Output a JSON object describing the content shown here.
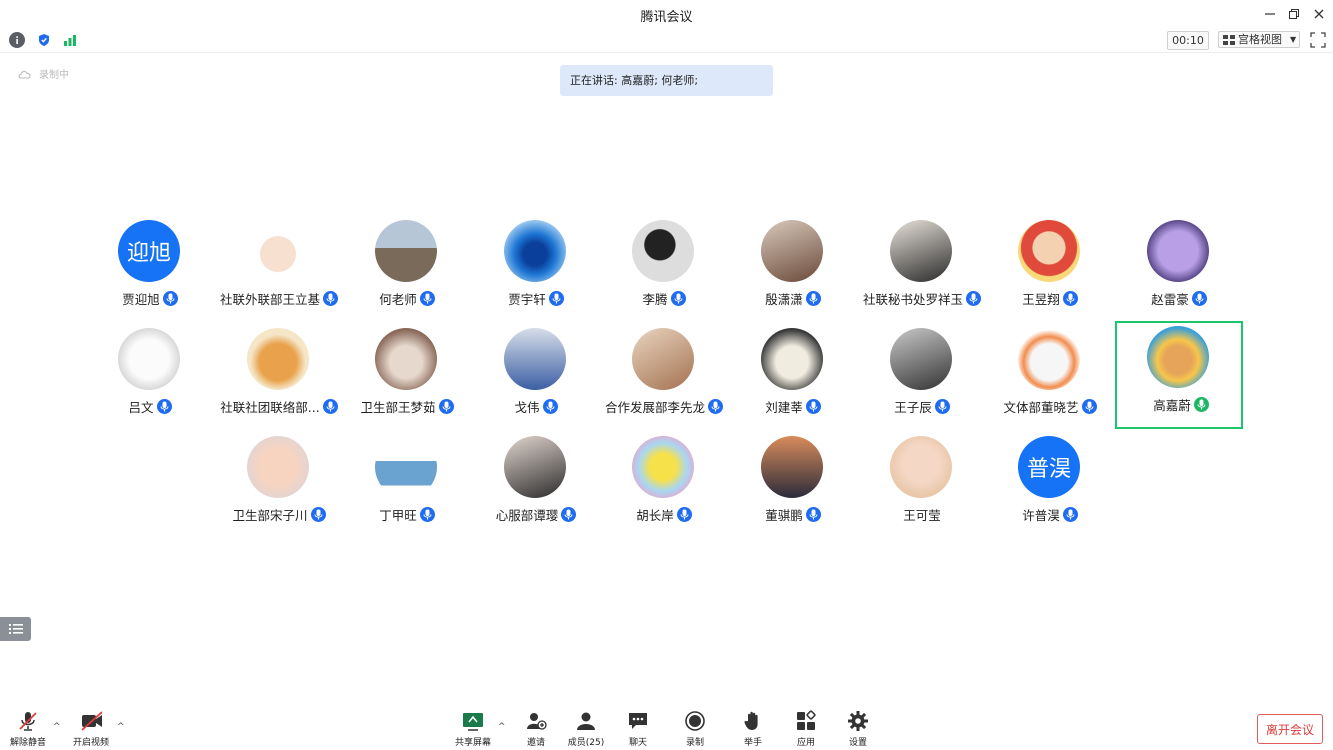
{
  "window": {
    "title": "腾讯会议"
  },
  "status": {
    "timer": "00:10",
    "view_label": "宫格视图"
  },
  "recording_label": "录制中",
  "speaking": "正在讲话: 高嘉蔚; 何老师;",
  "participants": [
    {
      "name": "贾迎旭",
      "avatar_text": "迎旭",
      "style": "text"
    },
    {
      "name": "社联外联部王立基",
      "style": "bear"
    },
    {
      "name": "何老师",
      "style": "street",
      "mic": "unmuted-blue"
    },
    {
      "name": "贾宇轩",
      "style": "bluegradient"
    },
    {
      "name": "李腾",
      "style": "silhouette"
    },
    {
      "name": "殷潇潇",
      "style": "girl1"
    },
    {
      "name": "社联秘书处罗祥玉",
      "style": "girl2"
    },
    {
      "name": "王昱翔",
      "style": "shinchan"
    },
    {
      "name": "赵雷豪",
      "style": "purplecartoon"
    },
    {
      "name": "吕文",
      "style": "dog"
    },
    {
      "name": "社联社团联络部...",
      "style": "shiba"
    },
    {
      "name": "卫生部王梦茹",
      "style": "cat"
    },
    {
      "name": "戈伟",
      "style": "child"
    },
    {
      "name": "合作发展部李先龙",
      "style": "man1"
    },
    {
      "name": "刘建莘",
      "style": "plush"
    },
    {
      "name": "王子辰",
      "style": "bw"
    },
    {
      "name": "文体部董晓艺",
      "style": "duck"
    },
    {
      "name": "高嘉蔚",
      "style": "sunmonster",
      "active": true
    },
    {
      "name": "卫生部宋子川",
      "style": "shinchan2"
    },
    {
      "name": "丁甲旺",
      "style": "skater"
    },
    {
      "name": "心服部谭璎",
      "style": "girl3"
    },
    {
      "name": "胡长岸",
      "style": "pikachu"
    },
    {
      "name": "董骐鹏",
      "style": "sunset"
    },
    {
      "name": "王可莹",
      "style": "girl4",
      "no_mic": true
    },
    {
      "name": "许普淏",
      "avatar_text": "普淏",
      "style": "text"
    }
  ],
  "toolbar": {
    "unmute": "解除静音",
    "start_video": "开启视频",
    "share": "共享屏幕",
    "invite": "邀请",
    "members": "成员(25)",
    "chat": "聊天",
    "record": "录制",
    "raise_hand": "举手",
    "apps": "应用",
    "settings": "设置",
    "leave": "离开会议"
  },
  "colors": {
    "accent": "#1673f5",
    "active_border": "#1cc46a",
    "leave_red": "#e03b3b"
  }
}
